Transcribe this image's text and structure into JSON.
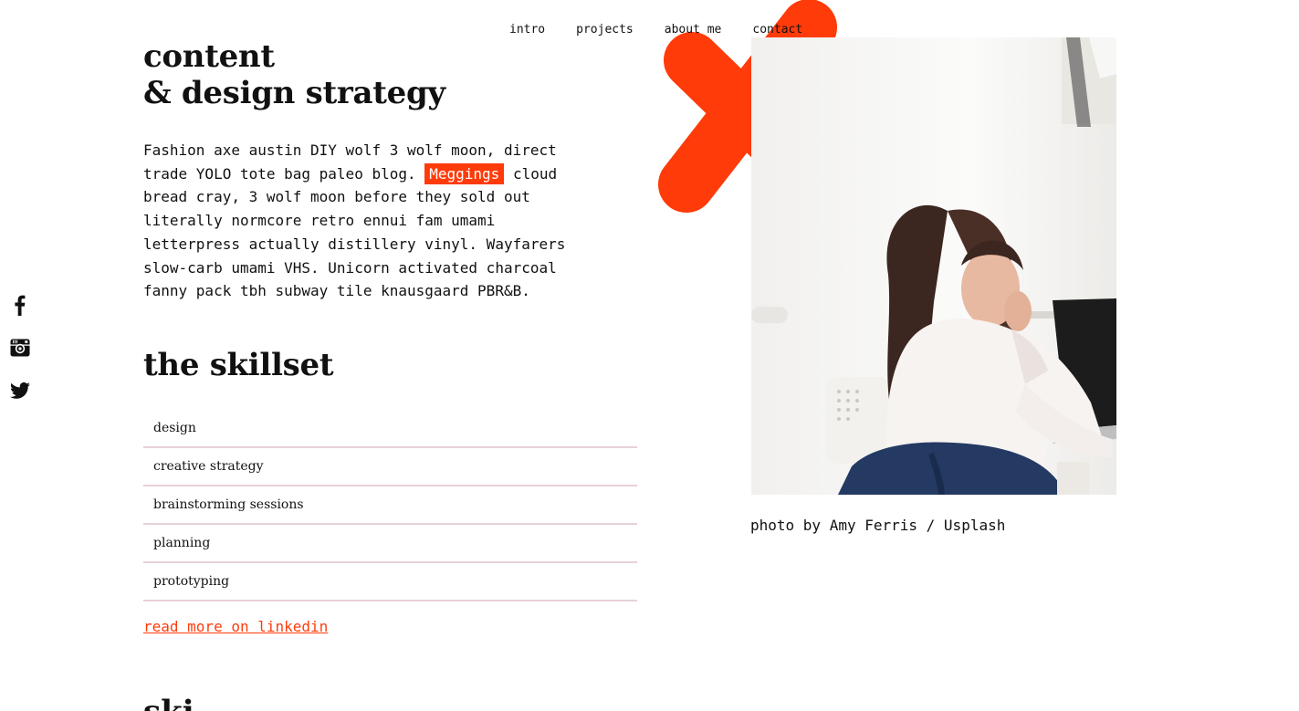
{
  "nav": {
    "items": [
      "intro",
      "projects",
      "about me",
      "contact"
    ]
  },
  "social": {
    "icons": [
      "facebook-icon",
      "instagram-icon",
      "twitter-icon"
    ]
  },
  "intro": {
    "title_line1": "content",
    "title_line2": "& design strategy",
    "text_before": "Fashion axe austin DIY wolf 3 wolf moon, direct trade YOLO tote bag paleo blog. ",
    "highlight": "Meggings",
    "text_after": " cloud bread cray, 3 wolf moon before they sold out literally normcore retro ennui fam umami letterpress actually distillery vinyl. Wayfarers slow-carb umami VHS. Unicorn activated charcoal fanny pack tbh subway tile knausgaard PBR&B."
  },
  "skills": {
    "title": "the skillset",
    "items": [
      "design",
      "creative strategy",
      "brainstorming sessions",
      "planning",
      "prototyping"
    ]
  },
  "linkedin_link": "read more on linkedin",
  "photo": {
    "caption": "photo by Amy Ferris / Usplash"
  },
  "next_section": {
    "title_partial": "ski"
  },
  "colors": {
    "accent": "#ff3b0a",
    "divider": "#e8d2d6",
    "text": "#111111",
    "background": "#ffffff"
  }
}
